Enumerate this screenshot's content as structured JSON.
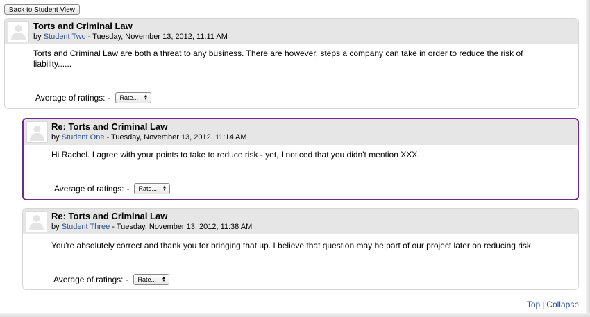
{
  "toolbar": {
    "back_label": "Back to Student View"
  },
  "posts": [
    {
      "title": "Torts and Criminal Law",
      "by": "by",
      "author": "Student Two",
      "date": " - Tuesday, November 13, 2012, 11:11 AM",
      "body": "Torts and Criminal Law are both a threat to any business. There are however, steps a company can take in order to reduce the risk of liability......",
      "ratings_label": "Average of ratings:",
      "ratings_value": "-",
      "rate_label": "Rate...",
      "highlighted": false
    },
    {
      "title": "Re: Torts and Criminal Law",
      "by": "by",
      "author": "Student One",
      "date": " - Tuesday, November 13, 2012, 11:14 AM",
      "body": "Hi Rachel.  I agree with your points to take to reduce risk - yet, I noticed that you didn't mention XXX.",
      "ratings_label": "Average of ratings:",
      "ratings_value": "-",
      "rate_label": "Rate...",
      "highlighted": true
    },
    {
      "title": "Re: Torts and Criminal Law",
      "by": "by",
      "author": "Student Three",
      "date": " - Tuesday, November 13, 2012, 11:38 AM",
      "body": "You're absolutely correct and thank you for bringing that up. I believe that question may be part of our project later on reducing risk.",
      "ratings_label": "Average of ratings:",
      "ratings_value": "-",
      "rate_label": "Rate...",
      "highlighted": false
    }
  ],
  "footer": {
    "top_label": "Top",
    "separator": "|",
    "collapse_label": "Collapse"
  },
  "colors": {
    "link": "#2a4f96",
    "highlight_border": "#6b2a8c",
    "header_bg": "#e6e6e6"
  },
  "icons": {
    "avatar": "default-user-avatar-icon",
    "select_arrows": "up-down-arrows-icon"
  }
}
